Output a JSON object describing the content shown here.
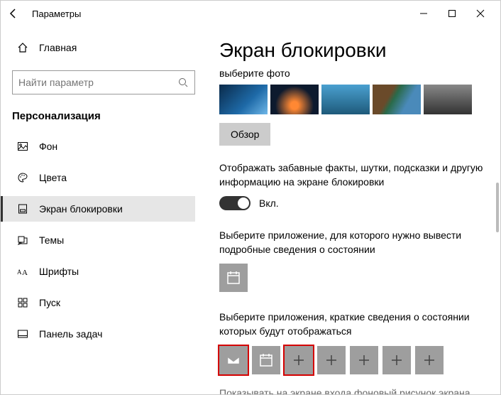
{
  "titlebar": {
    "title": "Параметры"
  },
  "sidebar": {
    "home": "Главная",
    "search_placeholder": "Найти параметр",
    "section": "Персонализация",
    "items": [
      {
        "label": "Фон"
      },
      {
        "label": "Цвета"
      },
      {
        "label": "Экран блокировки"
      },
      {
        "label": "Темы"
      },
      {
        "label": "Шрифты"
      },
      {
        "label": "Пуск"
      },
      {
        "label": "Панель задач"
      }
    ]
  },
  "main": {
    "heading": "Экран блокировки",
    "choose_photo": "выберите фото",
    "browse": "Обзор",
    "fun_facts": "Отображать забавные факты, шутки, подсказки и другую информацию на экране блокировки",
    "toggle_on": "Вкл.",
    "detailed_app": "Выберите приложение, для которого нужно вывести подробные сведения о состоянии",
    "quick_apps": "Выберите приложения, краткие сведения о состоянии которых будут отображаться",
    "cut": "Показывать на экране входа фоновый рисунок экрана"
  }
}
